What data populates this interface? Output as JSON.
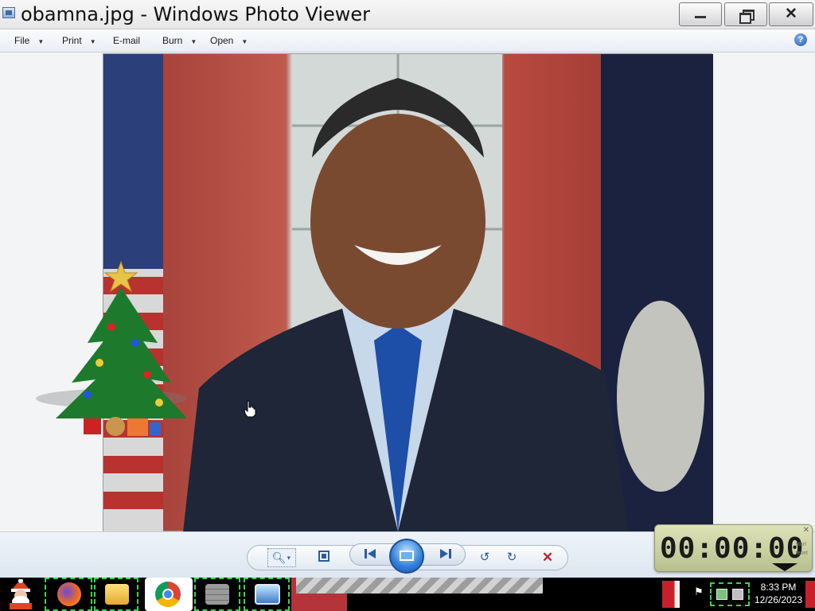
{
  "window": {
    "title": "obamna.jpg - Windows Photo Viewer",
    "min_glyph": "",
    "close_glyph": "✕"
  },
  "menu": {
    "items": [
      {
        "label": "File",
        "has_dropdown": true
      },
      {
        "label": "Print",
        "has_dropdown": true
      },
      {
        "label": "E-mail",
        "has_dropdown": false
      },
      {
        "label": "Burn",
        "has_dropdown": true
      },
      {
        "label": "Open",
        "has_dropdown": true
      }
    ],
    "help_icon": "?"
  },
  "viewer": {
    "image_description": "Photo of a smiling man in a dark suit and blue polka-dot tie, with US flag and presidential flag in front of red curtains"
  },
  "desktop_overlay": {
    "tree": "christmas-tree-icon"
  },
  "controls": {
    "zoom_icon": "magnifier-icon",
    "actual_size_icon": "fit-window-icon",
    "previous_icon": "previous-icon",
    "slideshow_icon": "slideshow-icon",
    "next_icon": "next-icon",
    "rotate_ccw_icon": "rotate-counterclockwise-icon",
    "rotate_cw_icon": "rotate-clockwise-icon",
    "delete_icon": "delete-icon"
  },
  "stopwatch": {
    "time": "00:00:00",
    "side_text_1": "start",
    "side_text_2": "reset"
  },
  "taskbar": {
    "items": [
      "santa-start-icon",
      "firefox-icon",
      "file-explorer-icon",
      "chrome-icon",
      "wall-icon",
      "photo-viewer-icon"
    ],
    "clock_time": "8:33 PM",
    "clock_date": "12/26/2023"
  },
  "colors": {
    "accent": "#2f7ed9",
    "taskbar": "#000000",
    "delete": "#c8202a",
    "stopwatch_bg": "#cfd5a6"
  }
}
